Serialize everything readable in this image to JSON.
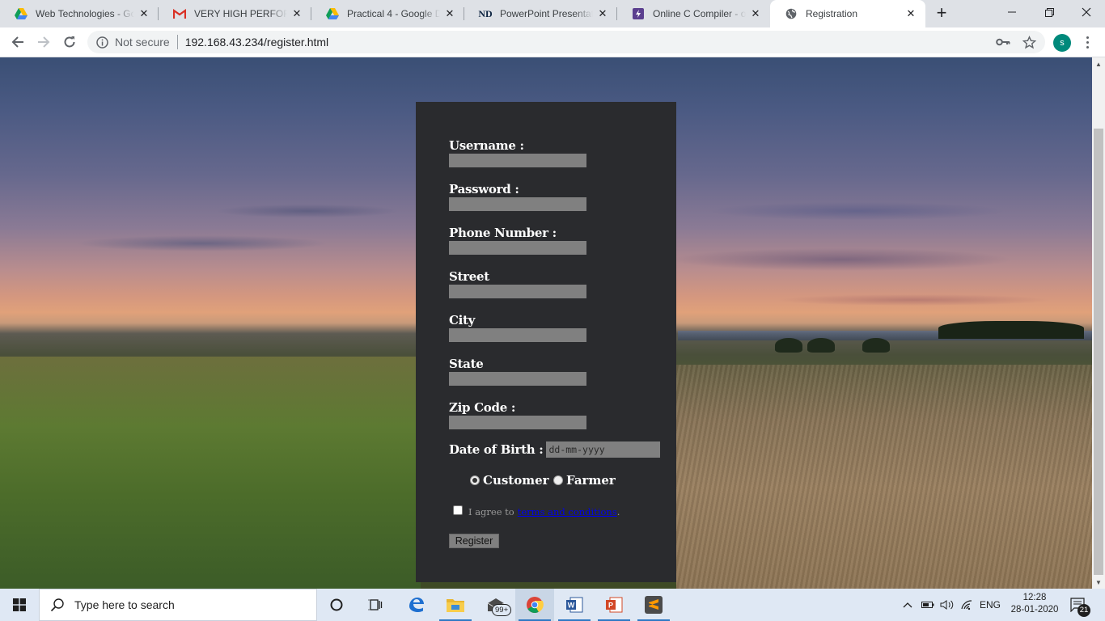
{
  "browser": {
    "tabs": [
      {
        "title": "Web Technologies - Go",
        "icon": "google-drive-icon"
      },
      {
        "title": "VERY HIGH PERFORMA",
        "icon": "gmail-icon"
      },
      {
        "title": "Practical 4 - Google Dri",
        "icon": "google-drive-icon"
      },
      {
        "title": "PowerPoint Presentation",
        "icon": "notre-dame-icon"
      },
      {
        "title": "Online C Compiler - onl",
        "icon": "bolt-icon"
      },
      {
        "title": "Registration",
        "icon": "globe-icon",
        "active": true
      }
    ],
    "security_label": "Not secure",
    "url": "192.168.43.234/register.html",
    "profile_initial": "s"
  },
  "form": {
    "fields": [
      {
        "label": "Username :"
      },
      {
        "label": "Password :"
      },
      {
        "label": "Phone Number :"
      },
      {
        "label": "Street"
      },
      {
        "label": "City"
      },
      {
        "label": "State"
      },
      {
        "label": "Zip Code :"
      }
    ],
    "dob_label": "Date of Birth :",
    "dob_placeholder": "dd-mm-yyyy",
    "roles": [
      {
        "label": "Customer",
        "selected": true
      },
      {
        "label": "Farmer",
        "selected": false
      }
    ],
    "agree_text": "I agree to",
    "terms_link": "terms and conditions",
    "agree_suffix": ".",
    "agree_checked": false,
    "register_label": "Register",
    "panel_color": "#2a2b2e",
    "input_color": "#808080"
  },
  "taskbar": {
    "search_placeholder": "Type here to search",
    "mail_badge": "99+",
    "language": "ENG",
    "time": "12:28",
    "date": "28-01-2020",
    "notification_count": "21"
  }
}
